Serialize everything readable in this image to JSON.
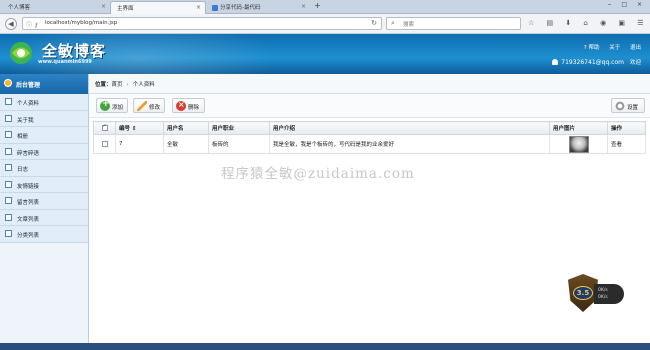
{
  "browser": {
    "tabs": [
      {
        "label": "个人博客"
      },
      {
        "label": "主界面"
      },
      {
        "label": "分享代码-最代码"
      }
    ],
    "new_tab": "+",
    "url": "localhost/myblog/main.jsp",
    "search_placeholder": "搜索"
  },
  "header": {
    "logo_text": "全敏博客",
    "logo_sub": "www.quanmin6999",
    "help": "帮助",
    "about": "关于",
    "exit": "退出",
    "user": "719326741@qq.com",
    "welcome": "欢迎"
  },
  "sidebar": {
    "title": "后台管理",
    "items": [
      {
        "label": "个人资料"
      },
      {
        "label": "关于我"
      },
      {
        "label": "相册"
      },
      {
        "label": "碎言碎语"
      },
      {
        "label": "日志"
      },
      {
        "label": "友情链接"
      },
      {
        "label": "留言列表"
      },
      {
        "label": "文章列表"
      },
      {
        "label": "分类列表"
      }
    ]
  },
  "breadcrumb": {
    "label": "位置：",
    "home": "首页",
    "separator": "›",
    "current": "个人资料"
  },
  "toolbar": {
    "add": "添加",
    "edit": "修改",
    "delete": "删除",
    "settings": "设置"
  },
  "table": {
    "headers": {
      "id": "编号 ⇕",
      "name": "用户名",
      "job": "用户职业",
      "intro": "用户介绍",
      "photo": "用户图片",
      "action": "操作"
    },
    "rows": [
      {
        "id": "7",
        "name": "全敏",
        "job": "板砖的",
        "intro": "我是全敏，我是个板砖的，写代码是我的业余爱好",
        "action": "查看"
      }
    ]
  },
  "watermark": "程序猿全敏@zuidaima.com",
  "badge": {
    "level": "3.5",
    "stat1": "0K/s",
    "stat2": "0K/s"
  },
  "colors": {
    "header_blue": "#1d8fd0",
    "sidebar_bg": "#e1edf8",
    "add_green": "#45a53c",
    "delete_red": "#d73a2f"
  }
}
